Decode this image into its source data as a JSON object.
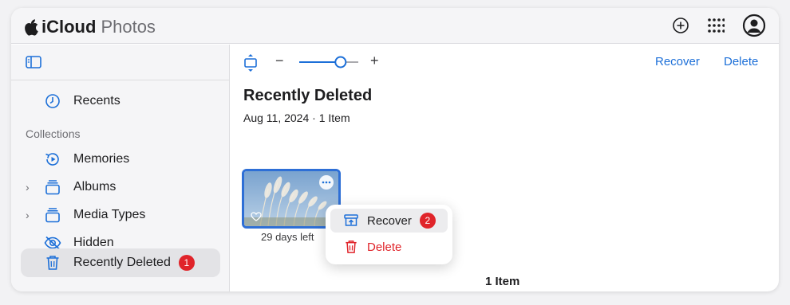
{
  "app": {
    "brand_name": "iCloud",
    "product_name": "Photos"
  },
  "topbar": {
    "icons": [
      "add-icon",
      "app-grid-icon",
      "account-icon"
    ]
  },
  "sidebar": {
    "toggle_icon": "sidebar-toggle-icon",
    "recents_label": "Recents",
    "section_label": "Collections",
    "items": [
      {
        "label": "Memories",
        "icon": "memories-icon",
        "expandable": false
      },
      {
        "label": "Albums",
        "icon": "albums-icon",
        "expandable": true
      },
      {
        "label": "Media Types",
        "icon": "media-types-icon",
        "expandable": true
      },
      {
        "label": "Hidden",
        "icon": "eye-slash-icon",
        "expandable": false
      },
      {
        "label": "Recently Deleted",
        "icon": "trash-icon",
        "expandable": false,
        "active": true,
        "badge": "1"
      }
    ]
  },
  "toolbar": {
    "zoom_minus": "−",
    "zoom_plus": "+",
    "zoom_level": 0.7,
    "recover_label": "Recover",
    "delete_label": "Delete"
  },
  "main": {
    "title": "Recently Deleted",
    "subtitle": "Aug 11, 2024 · 1 Item",
    "photo": {
      "days_left": "29 days left"
    },
    "footer_count": "1 Item"
  },
  "context_menu": {
    "items": [
      {
        "label": "Recover",
        "icon": "recover-icon",
        "badge": "2"
      },
      {
        "label": "Delete",
        "icon": "trash-icon"
      }
    ]
  },
  "colors": {
    "accent": "#1c6fd8",
    "destructive": "#e0242a",
    "selection": "#2e6fd6"
  }
}
